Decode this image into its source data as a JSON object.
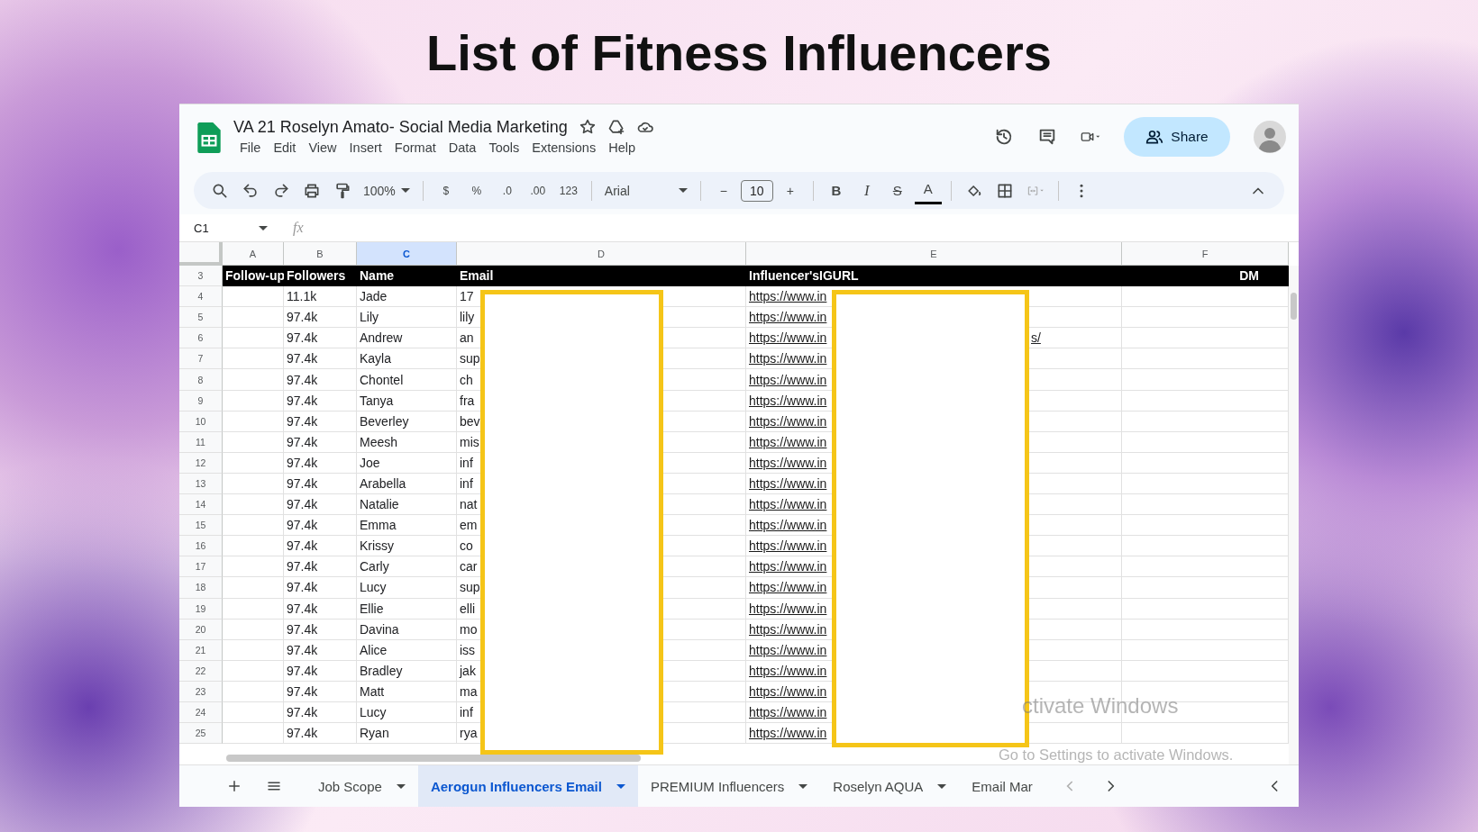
{
  "title": "List of Fitness Influencers",
  "doc": {
    "title": "VA 21 Roselyn Amato- Social Media Marketing",
    "menus": [
      "File",
      "Edit",
      "View",
      "Insert",
      "Format",
      "Data",
      "Tools",
      "Extensions",
      "Help"
    ],
    "share": "Share"
  },
  "toolbar": {
    "zoom": "100%",
    "currency": "$",
    "percent": "%",
    "decrease_decimals": ".0",
    "increase_decimals": ".00",
    "number_format": "123",
    "font": "Arial",
    "minus": "−",
    "font_size": "10",
    "plus": "+",
    "bold": "B",
    "italic": "I",
    "strike": "S",
    "text_color": "A"
  },
  "name_box": "C1",
  "formula_label": "fx",
  "columns": [
    {
      "label": "A",
      "selected": false
    },
    {
      "label": "B",
      "selected": false
    },
    {
      "label": "C",
      "selected": true
    },
    {
      "label": "D",
      "selected": false
    },
    {
      "label": "E",
      "selected": false
    },
    {
      "label": "F",
      "selected": false
    }
  ],
  "header_row": {
    "number": "3",
    "cells": [
      "Follow-up",
      "Followers",
      "Name",
      "Email",
      "Influencer'sIGURL",
      "DM"
    ]
  },
  "rows": [
    {
      "number": "4",
      "followers": "11.1k",
      "name": "Jade",
      "email": "17",
      "url": "https://www.in"
    },
    {
      "number": "5",
      "followers": "97.4k",
      "name": "Lily",
      "email": "lily",
      "url": "https://www.in"
    },
    {
      "number": "6",
      "followers": "97.4k",
      "name": "Andrew",
      "email": "an",
      "url": "https://www.in",
      "url_tail": "s/"
    },
    {
      "number": "7",
      "followers": "97.4k",
      "name": "Kayla",
      "email": "sup",
      "url": "https://www.in"
    },
    {
      "number": "8",
      "followers": "97.4k",
      "name": "Chontel",
      "email": "ch",
      "url": "https://www.in"
    },
    {
      "number": "9",
      "followers": "97.4k",
      "name": "Tanya",
      "email": "fra",
      "url": "https://www.in"
    },
    {
      "number": "10",
      "followers": "97.4k",
      "name": "Beverley",
      "email": "bev",
      "url": "https://www.in"
    },
    {
      "number": "11",
      "followers": "97.4k",
      "name": "Meesh",
      "email": "mis",
      "url": "https://www.in"
    },
    {
      "number": "12",
      "followers": "97.4k",
      "name": "Joe",
      "email": "inf",
      "url": "https://www.in"
    },
    {
      "number": "13",
      "followers": "97.4k",
      "name": "Arabella",
      "email": "inf",
      "url": "https://www.in"
    },
    {
      "number": "14",
      "followers": "97.4k",
      "name": "Natalie",
      "email": "nat",
      "url": "https://www.in"
    },
    {
      "number": "15",
      "followers": "97.4k",
      "name": "Emma",
      "email": "em",
      "url": "https://www.in"
    },
    {
      "number": "16",
      "followers": "97.4k",
      "name": "Krissy",
      "email": "co",
      "url": "https://www.in"
    },
    {
      "number": "17",
      "followers": "97.4k",
      "name": "Carly",
      "email": "car",
      "url": "https://www.in"
    },
    {
      "number": "18",
      "followers": "97.4k",
      "name": "Lucy",
      "email": "sup",
      "url": "https://www.in"
    },
    {
      "number": "19",
      "followers": "97.4k",
      "name": "Ellie",
      "email": "elli",
      "url": "https://www.in"
    },
    {
      "number": "20",
      "followers": "97.4k",
      "name": "Davina",
      "email": "mo",
      "url": "https://www.in"
    },
    {
      "number": "21",
      "followers": "97.4k",
      "name": "Alice",
      "email": "iss",
      "url": "https://www.in"
    },
    {
      "number": "22",
      "followers": "97.4k",
      "name": "Bradley",
      "email": "jak",
      "url": "https://www.in"
    },
    {
      "number": "23",
      "followers": "97.4k",
      "name": "Matt",
      "email": "ma",
      "url": "https://www.in"
    },
    {
      "number": "24",
      "followers": "97.4k",
      "name": "Lucy",
      "email": "inf",
      "url": "https://www.in"
    },
    {
      "number": "25",
      "followers": "97.4k",
      "name": "Ryan",
      "email": "rya",
      "url": "https://www.in"
    }
  ],
  "os_notice": [
    "ctivate Windows",
    "Go to Settings to activate Windows."
  ],
  "sheet_tabs": [
    {
      "label": "Job Scope",
      "selected": false
    },
    {
      "label": "Aerogun Influencers Email",
      "selected": true
    },
    {
      "label": "PREMIUM Influencers",
      "selected": false
    },
    {
      "label": "Roselyn AQUA",
      "selected": false
    },
    {
      "label": "Email Mar",
      "selected": false
    }
  ]
}
